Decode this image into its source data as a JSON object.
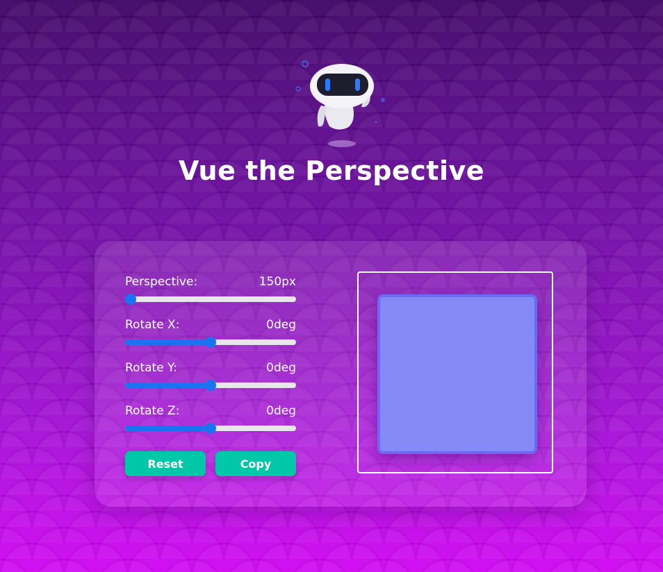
{
  "app": {
    "title": "Vue the Perspective"
  },
  "controls": [
    {
      "label": "Perspective:",
      "value": "150px",
      "level": 0.0
    },
    {
      "label": "Rotate X:",
      "value": "0deg",
      "level": 0.5
    },
    {
      "label": "Rotate Y:",
      "value": "0deg",
      "level": 0.5
    },
    {
      "label": "Rotate Z:",
      "value": "0deg",
      "level": 0.5
    }
  ],
  "buttons": {
    "reset_label": "Reset",
    "copy_label": "Copy"
  },
  "colors": {
    "accent": "#1a73f0",
    "button": "#00c7a7",
    "box_fill": "#848bf6",
    "box_border": "#6c6af3"
  },
  "icons": {
    "mascot": "robot-mascot-icon"
  }
}
